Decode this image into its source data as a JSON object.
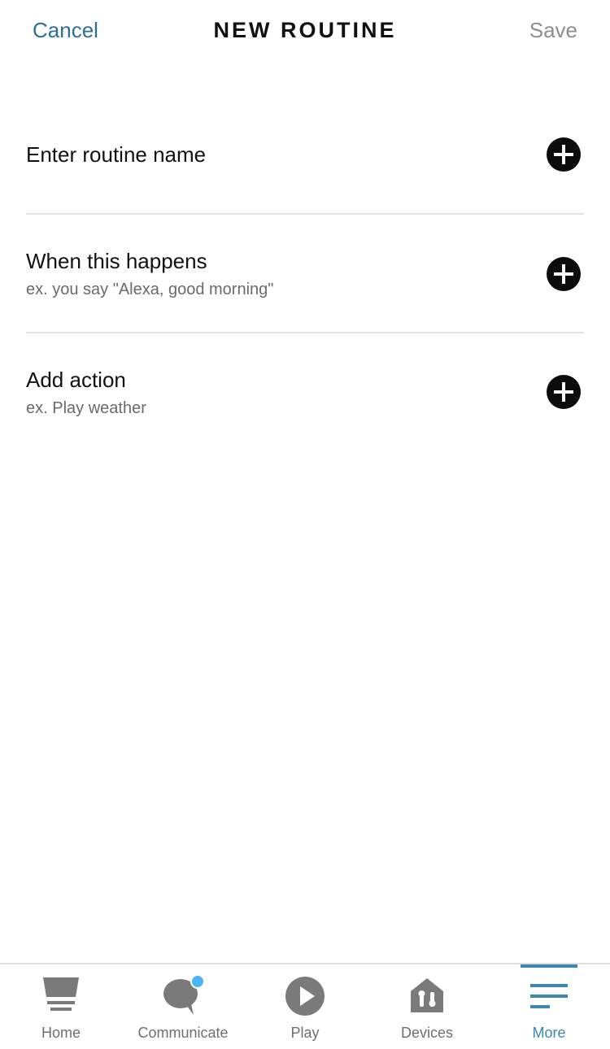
{
  "header": {
    "cancel_label": "Cancel",
    "title": "NEW ROUTINE",
    "save_label": "Save"
  },
  "rows": [
    {
      "title": "Enter routine name",
      "subtitle": ""
    },
    {
      "title": "When this happens",
      "subtitle": "ex. you say \"Alexa, good morning\""
    },
    {
      "title": "Add action",
      "subtitle": "ex. Play weather"
    }
  ],
  "tabs": [
    {
      "label": "Home",
      "icon": "home-icon"
    },
    {
      "label": "Communicate",
      "icon": "chat-bubble-icon",
      "badge": true
    },
    {
      "label": "Play",
      "icon": "play-icon"
    },
    {
      "label": "Devices",
      "icon": "devices-house-icon"
    },
    {
      "label": "More",
      "icon": "menu-icon",
      "active": true
    }
  ],
  "colors": {
    "accent": "#3c86b0",
    "cancel": "#2e6f98",
    "save_disabled": "#8e8e8e",
    "badge": "#4ab5f0",
    "icon_gray": "#7a7a7a"
  }
}
